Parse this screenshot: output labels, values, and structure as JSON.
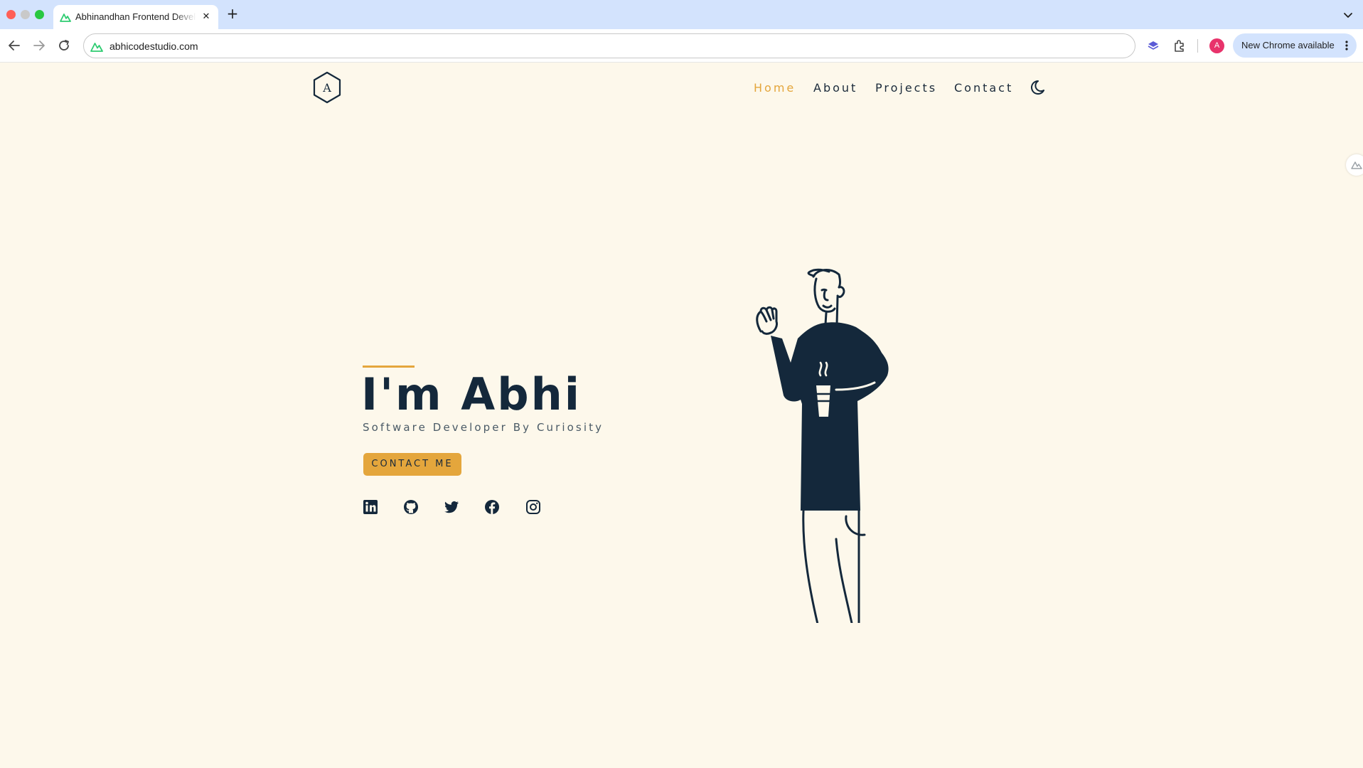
{
  "browser": {
    "tab": {
      "title": "Abhinandhan Frontend Developer",
      "favicon": "site-favicon"
    },
    "url": "abhicodestudio.com",
    "profile_initial": "A",
    "update_label": "New Chrome available"
  },
  "site": {
    "logo_letter": "A",
    "nav": [
      {
        "label": "Home",
        "active": true
      },
      {
        "label": "About",
        "active": false
      },
      {
        "label": "Projects",
        "active": false
      },
      {
        "label": "Contact",
        "active": false
      }
    ],
    "theme_toggle_icon": "moon-icon",
    "accent_color": "#e4a63c",
    "text_color": "#14283b",
    "background_color": "#fdf8eb"
  },
  "hero": {
    "title": "I'm Abhi",
    "subtitle": "Software Developer By Curiosity",
    "cta_label": "CONTACT ME",
    "socials": [
      "linkedin-icon",
      "github-icon",
      "twitter-icon",
      "facebook-icon",
      "instagram-icon"
    ]
  }
}
